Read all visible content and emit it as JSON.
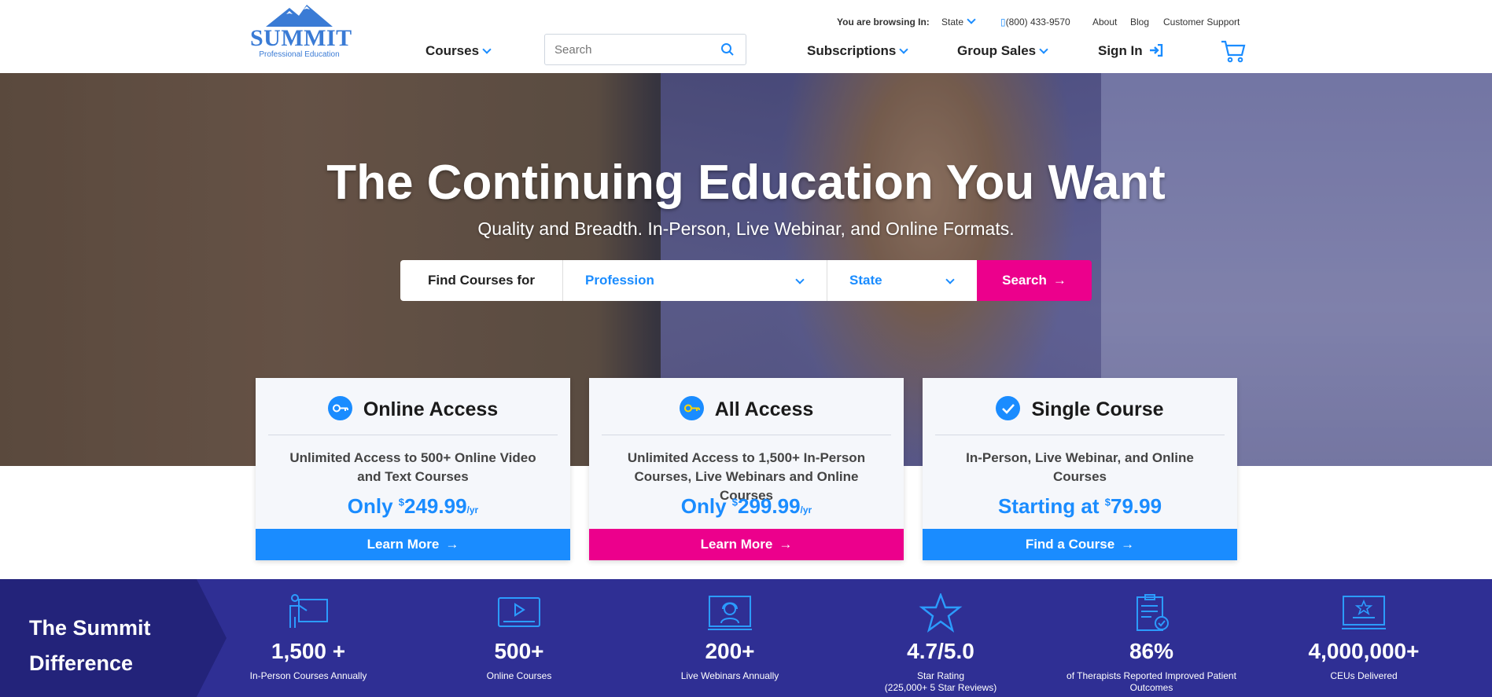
{
  "header": {
    "logo_text": "SUMMIT",
    "logo_sub": "Professional Education",
    "browsing_label": "You are browsing In:",
    "state_select": "State",
    "phone": "(800) 433-9570",
    "about": "About",
    "blog": "Blog",
    "support": "Customer Support",
    "nav": {
      "courses": "Courses",
      "subscriptions": "Subscriptions",
      "group_sales": "Group Sales",
      "sign_in": "Sign In"
    },
    "search_placeholder": "Search"
  },
  "hero": {
    "title": "The Continuing Education You Want",
    "subtitle": "Quality and Breadth. In-Person, Live Webinar, and Online Formats.",
    "finder": {
      "label": "Find Courses for",
      "profession": "Profession",
      "state": "State",
      "button": "Search"
    }
  },
  "cards": [
    {
      "title": "Online Access",
      "desc": "Unlimited Access to 500+ Online Video and Text Courses",
      "price_prefix": "Only",
      "price": "249.99",
      "price_suffix": "/yr",
      "cta": "Learn More",
      "cta_color": "#1a8cff"
    },
    {
      "title": "All Access",
      "desc": "Unlimited Access to 1,500+ In-Person Courses, Live Webinars and Online Courses",
      "price_prefix": "Only",
      "price": "299.99",
      "price_suffix": "/yr",
      "cta": "Learn More",
      "cta_color": "#ec008c"
    },
    {
      "title": "Single Course",
      "desc": "In-Person, Live Webinar, and Online Courses",
      "price_prefix": "Starting at",
      "price": "79.99",
      "price_suffix": "",
      "cta": "Find a Course",
      "cta_color": "#1a8cff"
    }
  ],
  "difference": {
    "title_line1": "The Summit",
    "title_line2": "Difference",
    "stats": [
      {
        "icon": "presenter-icon",
        "num": "1,500 +",
        "label": "In-Person Courses Annually"
      },
      {
        "icon": "video-player-icon",
        "num": "500+",
        "label": "Online Courses"
      },
      {
        "icon": "webinar-headset-icon",
        "num": "200+",
        "label": "Live Webinars Annually"
      },
      {
        "icon": "star-icon",
        "num": "4.7/5.0",
        "label": "Star Rating",
        "label2": "(225,000+ 5 Star Reviews)"
      },
      {
        "icon": "clipboard-check-icon",
        "num": "86%",
        "label": "of Therapists Reported Improved Patient",
        "label2": "Outcomes"
      },
      {
        "icon": "certificate-icon",
        "num": "4,000,000+",
        "label": "CEUs Delivered"
      }
    ]
  },
  "colors": {
    "brand_blue": "#1a8cff",
    "brand_pink": "#ec008c",
    "band_navy": "#2f2f94"
  }
}
